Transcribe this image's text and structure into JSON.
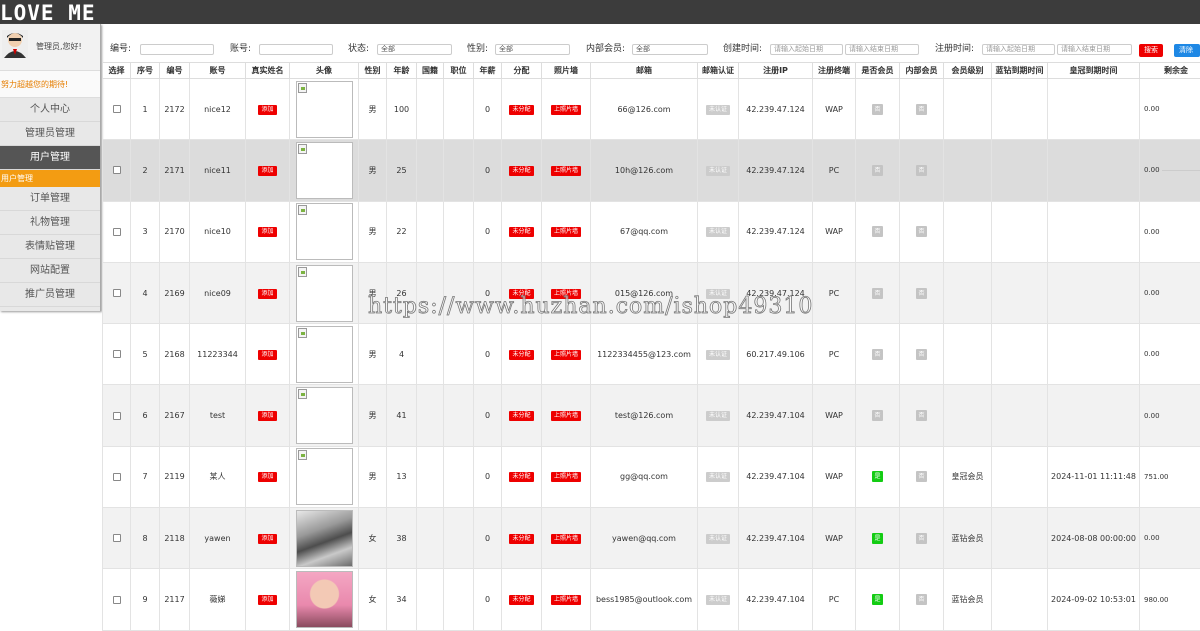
{
  "app": {
    "brand": "LOVE ME"
  },
  "sidebar": {
    "greeting": "管理员,您好!",
    "motto": "努力超越您的期待!",
    "items": [
      {
        "label": "个人中心",
        "active": false
      },
      {
        "label": "管理员管理",
        "active": false
      },
      {
        "label": "用户管理",
        "active": true
      }
    ],
    "sub_item": "用户管理",
    "items_after": [
      {
        "label": "订单管理"
      },
      {
        "label": "礼物管理"
      },
      {
        "label": "表情贴管理"
      },
      {
        "label": "网站配置"
      },
      {
        "label": "推广员管理"
      }
    ]
  },
  "filters": {
    "number_label": "编号:",
    "number_value": "",
    "account_label": "账号:",
    "account_value": "",
    "status_label": "状态:",
    "status_value": "全部",
    "gender_label": "性别:",
    "gender_value": "全部",
    "internal_label": "内部会员:",
    "internal_value": "全部",
    "created_label": "创建时间:",
    "created_start_placeholder": "请输入起始日期",
    "created_end_placeholder": "请输入结束日期",
    "register_label": "注册时间:",
    "register_start_placeholder": "请输入起始日期",
    "register_end_placeholder": "请输入结束日期",
    "search_button": "搜索",
    "clear_button": "清除搜"
  },
  "table": {
    "headers": [
      "选择",
      "序号",
      "编号",
      "账号",
      "真实姓名",
      "头像",
      "性别",
      "年龄",
      "国籍",
      "职位",
      "年薪",
      "分配",
      "照片墙",
      "邮箱",
      "邮箱认证",
      "注册IP",
      "注册终端",
      "是否会员",
      "内部会员",
      "会员级别",
      "蓝钻到期时间",
      "皇冠到期时间",
      "剩余金"
    ],
    "add_label": "添加",
    "assign_label": "未分配",
    "photo_label": "上照片墙",
    "verify_label": "未认证",
    "no_label": "否",
    "yes_label": "是",
    "rows": [
      {
        "seq": "1",
        "id": "2172",
        "account": "nice12",
        "avatar": "broken",
        "gender": "男",
        "age": "100",
        "salary": "0",
        "email": "66@126.com",
        "ip": "42.239.47.124",
        "terminal": "WAP",
        "member": false,
        "level": "",
        "blue_expire": "",
        "crown_expire": "",
        "balance": "0.00",
        "style": ""
      },
      {
        "seq": "2",
        "id": "2171",
        "account": "nice11",
        "avatar": "broken",
        "gender": "男",
        "age": "25",
        "salary": "0",
        "email": "10h@126.com",
        "ip": "42.239.47.124",
        "terminal": "PC",
        "member": false,
        "level": "",
        "blue_expire": "",
        "crown_expire": "",
        "balance": "0.00",
        "style": "sel"
      },
      {
        "seq": "3",
        "id": "2170",
        "account": "nice10",
        "avatar": "broken",
        "gender": "男",
        "age": "22",
        "salary": "0",
        "email": "67@qq.com",
        "ip": "42.239.47.124",
        "terminal": "WAP",
        "member": false,
        "level": "",
        "blue_expire": "",
        "crown_expire": "",
        "balance": "0.00",
        "style": ""
      },
      {
        "seq": "4",
        "id": "2169",
        "account": "nice09",
        "avatar": "broken",
        "gender": "男",
        "age": "26",
        "salary": "0",
        "email": "015@126.com",
        "ip": "42.239.47.124",
        "terminal": "PC",
        "member": false,
        "level": "",
        "blue_expire": "",
        "crown_expire": "",
        "balance": "0.00",
        "style": "alt"
      },
      {
        "seq": "5",
        "id": "2168",
        "account": "11223344",
        "avatar": "broken",
        "gender": "男",
        "age": "4",
        "salary": "0",
        "email": "1122334455@123.com",
        "ip": "60.217.49.106",
        "terminal": "PC",
        "member": false,
        "level": "",
        "blue_expire": "",
        "crown_expire": "",
        "balance": "0.00",
        "style": ""
      },
      {
        "seq": "6",
        "id": "2167",
        "account": "test",
        "avatar": "broken",
        "gender": "男",
        "age": "41",
        "salary": "0",
        "email": "test@126.com",
        "ip": "42.239.47.104",
        "terminal": "WAP",
        "member": false,
        "level": "",
        "blue_expire": "",
        "crown_expire": "",
        "balance": "0.00",
        "style": "alt"
      },
      {
        "seq": "7",
        "id": "2119",
        "account": "某人",
        "avatar": "broken",
        "gender": "男",
        "age": "13",
        "salary": "0",
        "email": "gg@qq.com",
        "ip": "42.239.47.104",
        "terminal": "WAP",
        "member": true,
        "level": "皇冠会员",
        "blue_expire": "",
        "crown_expire": "2024-11-01 11:11:48",
        "balance": "751.00",
        "style": ""
      },
      {
        "seq": "8",
        "id": "2118",
        "account": "yawen",
        "avatar": "watch",
        "gender": "女",
        "age": "38",
        "salary": "0",
        "email": "yawen@qq.com",
        "ip": "42.239.47.104",
        "terminal": "WAP",
        "member": true,
        "level": "蓝钻会员",
        "blue_expire": "",
        "crown_expire": "2024-08-08 00:00:00",
        "balance": "0.00",
        "style": "alt"
      },
      {
        "seq": "9",
        "id": "2117",
        "account": "薇娣",
        "avatar": "person",
        "gender": "女",
        "age": "34",
        "salary": "0",
        "email": "bess1985@outlook.com",
        "ip": "42.239.47.104",
        "terminal": "PC",
        "member": true,
        "level": "蓝钻会员",
        "blue_expire": "",
        "crown_expire": "2024-09-02 10:53:01",
        "balance": "980.00",
        "style": ""
      }
    ]
  },
  "watermark": "https://www.huzhan.com/ishop49310",
  "colors": {
    "topbar": "#3c3c3c",
    "accent_orange": "#f39c12",
    "red": "#ee0000",
    "green": "#13cc13",
    "blue": "#1e88e5"
  }
}
